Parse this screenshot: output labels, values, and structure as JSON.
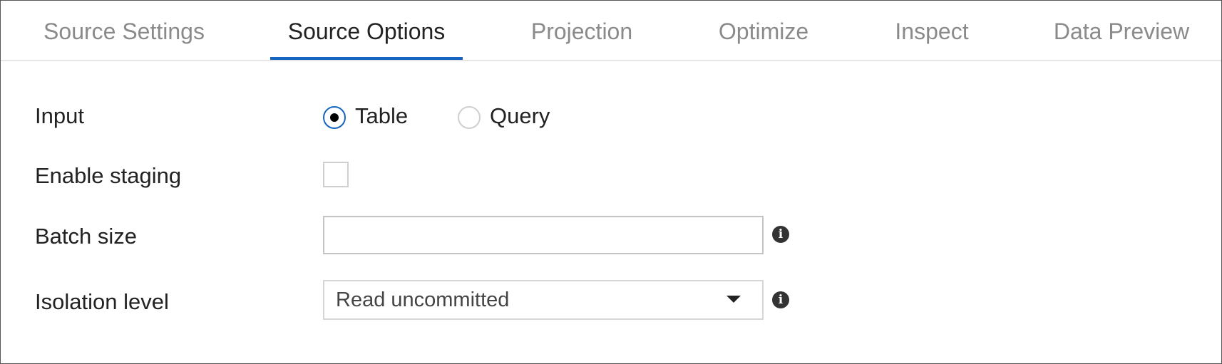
{
  "tabs": [
    {
      "label": "Source Settings",
      "active": false
    },
    {
      "label": "Source Options",
      "active": true
    },
    {
      "label": "Projection",
      "active": false
    },
    {
      "label": "Optimize",
      "active": false
    },
    {
      "label": "Inspect",
      "active": false
    },
    {
      "label": "Data Preview",
      "active": false
    }
  ],
  "form": {
    "input": {
      "label": "Input",
      "options": [
        {
          "label": "Table",
          "selected": true
        },
        {
          "label": "Query",
          "selected": false
        }
      ]
    },
    "enable_staging": {
      "label": "Enable staging",
      "checked": false
    },
    "batch_size": {
      "label": "Batch size",
      "value": ""
    },
    "isolation_level": {
      "label": "Isolation level",
      "value": "Read uncommitted"
    }
  },
  "icons": {
    "info": "info-icon",
    "dropdown": "chevron-down-icon"
  },
  "colors": {
    "accent": "#1565c0",
    "text": "#222222",
    "inactive_tab": "#8a8a8a"
  }
}
